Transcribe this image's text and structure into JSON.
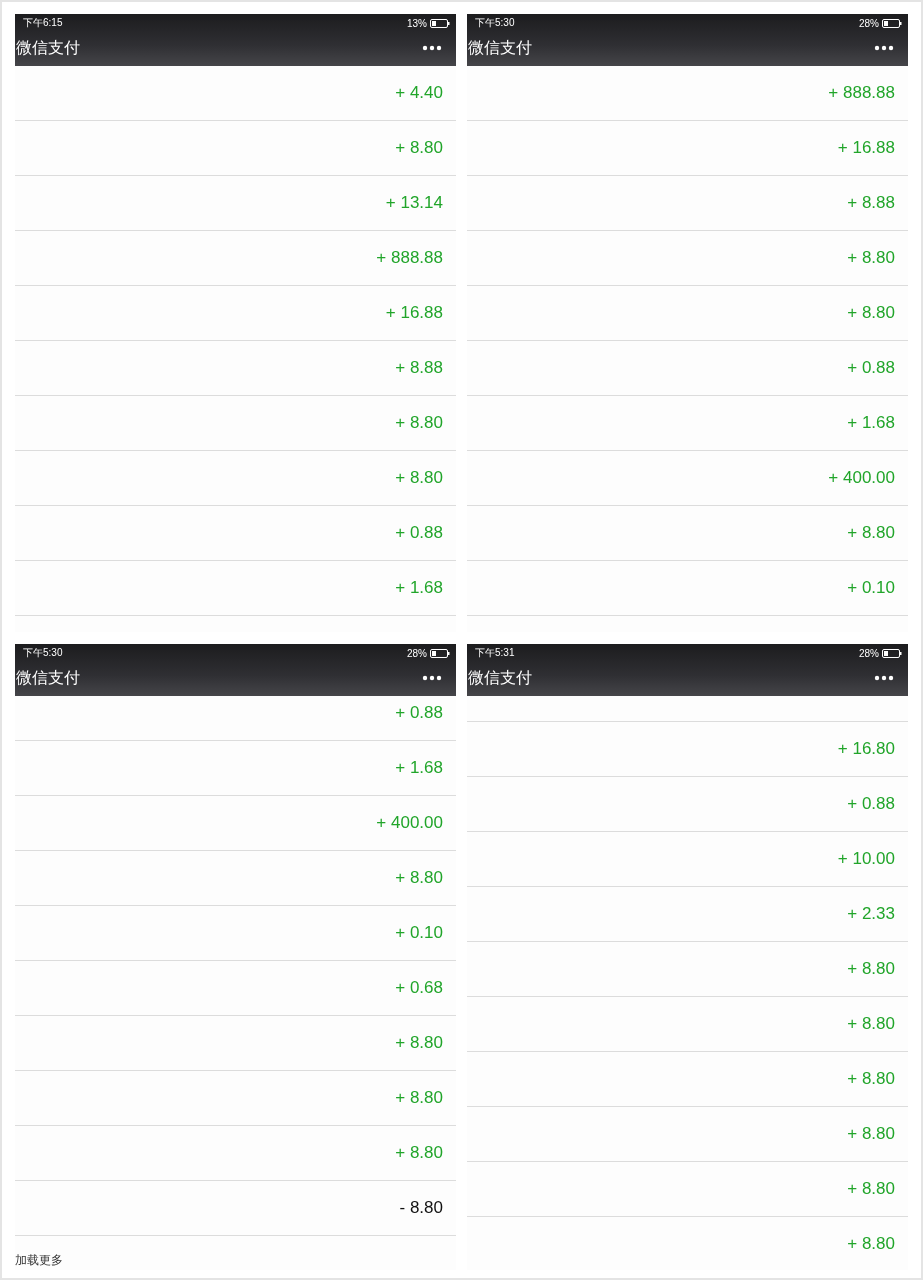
{
  "screens": [
    {
      "status_bar": {
        "time": "下午6:15",
        "battery": "13%"
      },
      "title": "微信支付",
      "amounts": [
        {
          "text": "+ 4.40",
          "kind": "income"
        },
        {
          "text": "+ 8.80",
          "kind": "income"
        },
        {
          "text": "+ 13.14",
          "kind": "income"
        },
        {
          "text": "+ 888.88",
          "kind": "income"
        },
        {
          "text": "+ 16.88",
          "kind": "income"
        },
        {
          "text": "+ 8.88",
          "kind": "income"
        },
        {
          "text": "+ 8.80",
          "kind": "income"
        },
        {
          "text": "+ 8.80",
          "kind": "income"
        },
        {
          "text": "+ 0.88",
          "kind": "income"
        },
        {
          "text": "+ 1.68",
          "kind": "income"
        }
      ]
    },
    {
      "status_bar": {
        "time": "下午5:30",
        "battery": "28%"
      },
      "title": "微信支付",
      "amounts": [
        {
          "text": "+ 888.88",
          "kind": "income"
        },
        {
          "text": "+ 16.88",
          "kind": "income"
        },
        {
          "text": "+ 8.88",
          "kind": "income"
        },
        {
          "text": "+ 8.80",
          "kind": "income"
        },
        {
          "text": "+ 8.80",
          "kind": "income"
        },
        {
          "text": "+ 0.88",
          "kind": "income"
        },
        {
          "text": "+ 1.68",
          "kind": "income"
        },
        {
          "text": "+ 400.00",
          "kind": "income"
        },
        {
          "text": "+ 8.80",
          "kind": "income"
        },
        {
          "text": "+ 0.10",
          "kind": "income"
        }
      ]
    },
    {
      "status_bar": {
        "time": "下午5:30",
        "battery": "28%"
      },
      "title": "微信支付",
      "amounts": [
        {
          "text": "+ 0.88",
          "kind": "income"
        },
        {
          "text": "+ 1.68",
          "kind": "income"
        },
        {
          "text": "+ 400.00",
          "kind": "income"
        },
        {
          "text": "+ 8.80",
          "kind": "income"
        },
        {
          "text": "+ 0.10",
          "kind": "income"
        },
        {
          "text": "+ 0.68",
          "kind": "income"
        },
        {
          "text": "+ 8.80",
          "kind": "income"
        },
        {
          "text": "+ 8.80",
          "kind": "income"
        },
        {
          "text": "+ 8.80",
          "kind": "income"
        },
        {
          "text": "- 8.80",
          "kind": "expense"
        }
      ],
      "load_more": "加载更多"
    },
    {
      "status_bar": {
        "time": "下午5:31",
        "battery": "28%"
      },
      "title": "微信支付",
      "amounts": [
        {
          "text": "+ 16.80",
          "kind": "income"
        },
        {
          "text": "+ 0.88",
          "kind": "income"
        },
        {
          "text": "+ 10.00",
          "kind": "income"
        },
        {
          "text": "+ 2.33",
          "kind": "income"
        },
        {
          "text": "+ 8.80",
          "kind": "income"
        },
        {
          "text": "+ 8.80",
          "kind": "income"
        },
        {
          "text": "+ 8.80",
          "kind": "income"
        },
        {
          "text": "+ 8.80",
          "kind": "income"
        },
        {
          "text": "+ 8.80",
          "kind": "income"
        },
        {
          "text": "+ 8.80",
          "kind": "income"
        }
      ]
    }
  ]
}
